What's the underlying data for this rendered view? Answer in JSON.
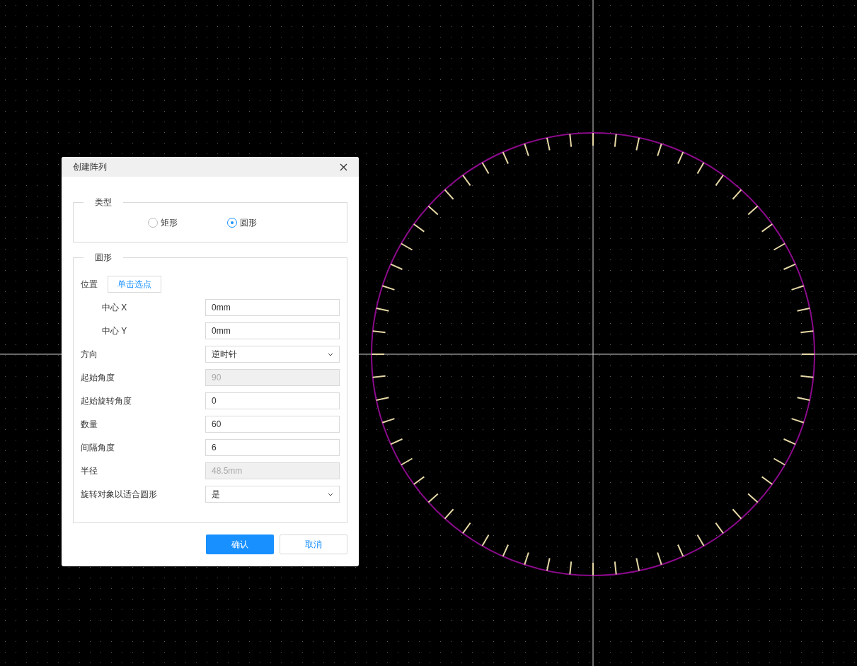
{
  "dialog": {
    "title": "创建阵列",
    "type_group": {
      "legend": "类型",
      "options": [
        {
          "label": "矩形",
          "selected": false
        },
        {
          "label": "圆形",
          "selected": true
        }
      ]
    },
    "circle_group": {
      "legend": "圆形",
      "rows": [
        {
          "kind": "button",
          "label": "位置",
          "value": "单击选点",
          "children": [
            {
              "kind": "input",
              "label": "中心 X",
              "value": "0mm",
              "disabled": false
            },
            {
              "kind": "input",
              "label": "中心 Y",
              "value": "0mm",
              "disabled": false
            }
          ]
        },
        {
          "kind": "select",
          "label": "方向",
          "value": "逆时针"
        },
        {
          "kind": "input",
          "label": "起始角度",
          "value": "90",
          "disabled": true
        },
        {
          "kind": "input",
          "label": "起始旋转角度",
          "value": "0",
          "disabled": false
        },
        {
          "kind": "input",
          "label": "数量",
          "value": "60",
          "disabled": false
        },
        {
          "kind": "input",
          "label": "间隔角度",
          "value": "6",
          "disabled": false
        },
        {
          "kind": "input",
          "label": "半径",
          "value": "48.5mm",
          "disabled": true
        },
        {
          "kind": "select",
          "label": "旋转对象以适合圆形",
          "value": "是"
        }
      ]
    },
    "buttons": [
      {
        "label": "确认",
        "kind": "primary"
      },
      {
        "label": "取消",
        "kind": "secondary"
      }
    ]
  }
}
